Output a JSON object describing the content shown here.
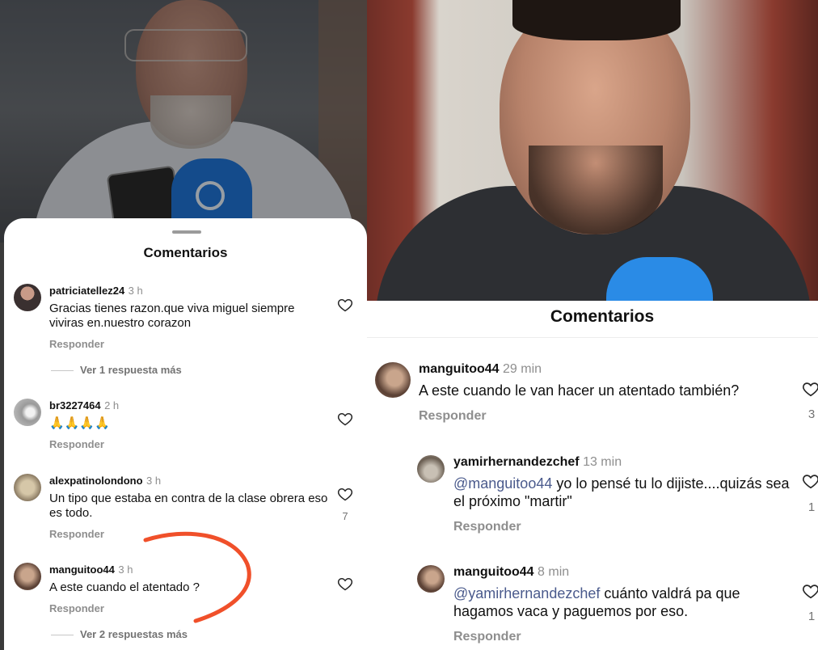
{
  "left": {
    "sheet_title": "Comentarios",
    "comments": [
      {
        "username": "patriciatellez24",
        "time": "3 h",
        "text": "Gracias tienes razon.que viva miguel siempre viviras en.nuestro corazon",
        "reply": "Responder",
        "more": "Ver 1 respuesta más"
      },
      {
        "username": "br3227464",
        "time": "2 h",
        "text": "🙏🙏🙏🙏",
        "reply": "Responder"
      },
      {
        "username": "alexpatinolondono",
        "time": "3 h",
        "text": "Un tipo que estaba en contra de la clase obrera eso es todo.",
        "reply": "Responder",
        "likes": "7"
      },
      {
        "username": "manguitoo44",
        "time": "3 h",
        "text": "A este cuando el atentado ?",
        "reply": "Responder",
        "more": "Ver 2 respuestas más"
      }
    ]
  },
  "right": {
    "sheet_title": "Comentarios",
    "comments": [
      {
        "username": "manguitoo44",
        "time": "29 min",
        "text": "A este cuando le van hacer un atentado también?",
        "reply": "Responder",
        "likes": "3"
      },
      {
        "username": "yamirhernandezchef",
        "time": "13 min",
        "mention": "@manguitoo44",
        "text": " yo lo pensé tu lo dijiste....quizás sea el próximo \"martir\"",
        "reply": "Responder",
        "likes": "1"
      },
      {
        "username": "manguitoo44",
        "time": "8 min",
        "mention": "@yamirhernandezchef",
        "text": " cuánto valdrá pa que hagamos vaca y paguemos por eso.",
        "reply": "Responder",
        "likes": "1"
      }
    ]
  },
  "colors": {
    "annotation": "#f0502a",
    "mic": "#1f74d6",
    "mention": "#4a5a8c"
  }
}
